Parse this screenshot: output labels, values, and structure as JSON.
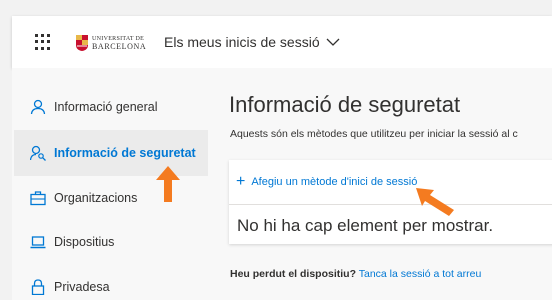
{
  "header": {
    "logo_line1": "UNIVERSITAT DE",
    "logo_line2": "BARCELONA",
    "app_title": "Els meus inicis de sessió"
  },
  "sidebar": {
    "items": [
      {
        "label": "Informació general",
        "icon": "person-icon",
        "selected": false
      },
      {
        "label": "Informació de seguretat",
        "icon": "security-info-icon",
        "selected": true
      },
      {
        "label": "Organitzacions",
        "icon": "briefcase-icon",
        "selected": false
      },
      {
        "label": "Dispositius",
        "icon": "laptop-icon",
        "selected": false
      },
      {
        "label": "Privadesa",
        "icon": "lock-icon",
        "selected": false
      }
    ]
  },
  "main": {
    "title": "Informació de seguretat",
    "subtitle": "Aquests són els mètodes que utilitzeu per iniciar la sessió al c",
    "add_method_label": "Afegiu un mètode d'inici de sessió",
    "empty_message": "No hi ha cap element per mostrar.",
    "lost_device_question": "Heu perdut el dispositiu?",
    "sign_out_link": "Tanca la sessió a tot arreu"
  },
  "colors": {
    "accent": "#0078d4",
    "annotation_arrow": "#f47b20",
    "text": "#323130"
  }
}
